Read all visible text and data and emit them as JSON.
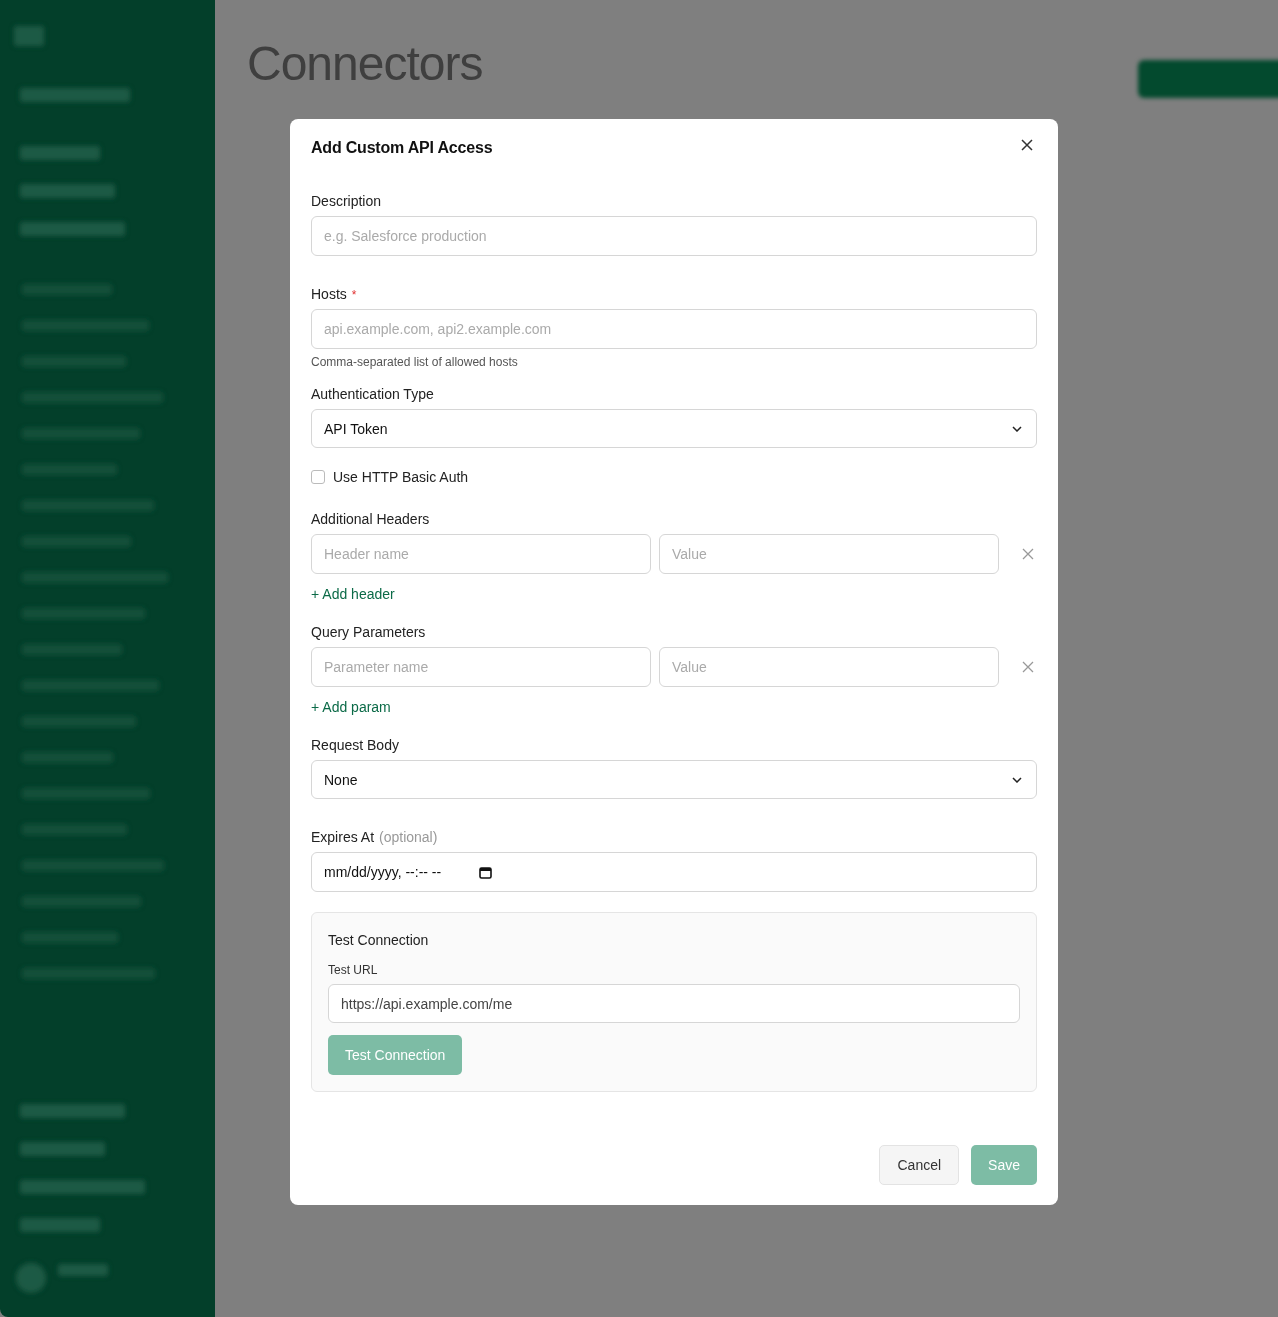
{
  "background": {
    "title": "Connectors"
  },
  "dialog": {
    "title": "Add Custom API Access",
    "description": {
      "label": "Description",
      "placeholder": "e.g. Salesforce production"
    },
    "hosts": {
      "label": "Hosts",
      "required_mark": "*",
      "placeholder": "api.example.com, api2.example.com",
      "hint": "Comma-separated list of allowed hosts"
    },
    "auth_type": {
      "label": "Authentication Type",
      "value": "API Token"
    },
    "basic_auth": {
      "label": "Use HTTP Basic Auth",
      "checked": false
    },
    "headers": {
      "label": "Additional Headers",
      "rows": [
        {
          "name_placeholder": "Header name",
          "value_placeholder": "Value"
        }
      ],
      "add_label": "+ Add header"
    },
    "query_params": {
      "label": "Query Parameters",
      "rows": [
        {
          "name_placeholder": "Parameter name",
          "value_placeholder": "Value"
        }
      ],
      "add_label": "+ Add param"
    },
    "request_body": {
      "label": "Request Body",
      "value": "None"
    },
    "expires_at": {
      "label": "Expires At",
      "note": "(optional)",
      "value": "mm/dd/yyyy, --:-- --"
    },
    "test": {
      "title": "Test Connection",
      "url_label": "Test URL",
      "url_value": "https://api.example.com/me",
      "button": {
        "label": "Test Connection",
        "disabled": true
      }
    },
    "actions": {
      "cancel": "Cancel",
      "save": {
        "label": "Save",
        "disabled": true
      }
    }
  }
}
